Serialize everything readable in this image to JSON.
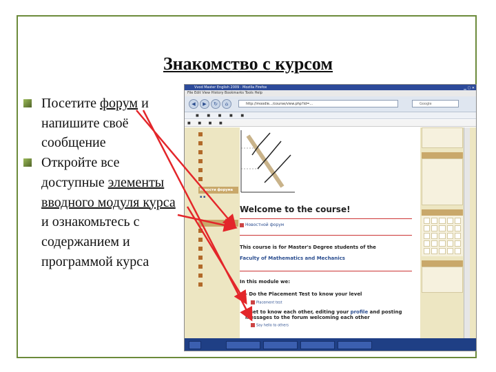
{
  "slide": {
    "title": "Знакомство с курсом",
    "bullet1_a": "Посетите ",
    "bullet1_link": "форум",
    "bullet1_b": " и напишите своё сообщение",
    "bullet2_a": "Откройте все доступные ",
    "bullet2_link": "элементы вводного модуля курса",
    "bullet2_b": " и ознакомьтесь с содержанием и программой курса"
  },
  "browser": {
    "window_title": "Vvod Master English 2009 · Mozilla Firefox",
    "menu": "File  Edit  View  History  Bookmarks  Tools  Help",
    "url": "http://moodle.../course/view.php?id=...",
    "search_placeholder": "Google"
  },
  "left_blocks": {
    "forum_header": "Новости форума"
  },
  "course": {
    "welcome": "Welcome to the course!",
    "news_link": "Новостной форум",
    "line1": "This course is for Master's Degree students of the",
    "line2": "Faculty of Mathematics and Mechanics",
    "in_module": "In this module we:",
    "step1": "- Do the Placement Test to know your level",
    "quiz_link": "Placement test",
    "step2_a": "- Get to know each other, editing your ",
    "step2_profile": "profile",
    "step2_b": " and posting messages to the forum welcoming each other",
    "forum_link": "Say hello to others"
  },
  "colors": {
    "frame": "#6b8a3a",
    "arrow": "#e3262a",
    "accent_header": "#c9a86a"
  }
}
